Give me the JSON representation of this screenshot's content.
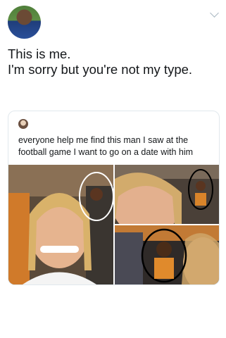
{
  "tweet": {
    "author_avatar_icon": "profile-avatar-icon",
    "text_line1": "This is me.",
    "text_line2": "I'm sorry but you're not my type."
  },
  "quoted_tweet": {
    "author_avatar_icon": "profile-avatar-icon",
    "text": "everyone help me find this man I saw at the football game I want to go on a date with him",
    "photos": [
      "photo-1",
      "photo-2",
      "photo-3"
    ]
  },
  "icons": {
    "menu": "chevron-down-icon"
  }
}
